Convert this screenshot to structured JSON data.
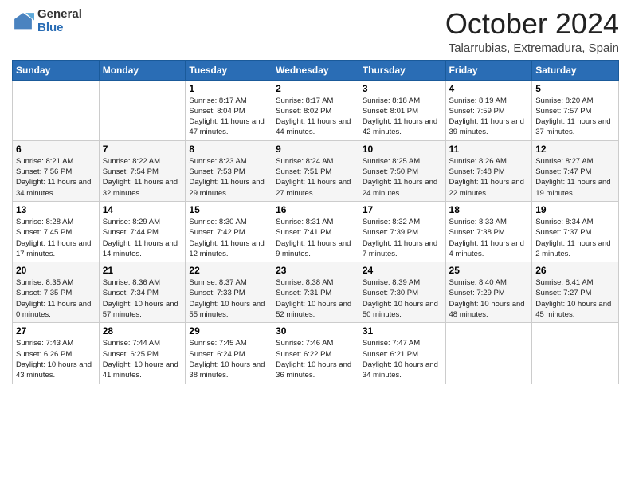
{
  "header": {
    "logo_general": "General",
    "logo_blue": "Blue",
    "title": "October 2024",
    "subtitle": "Talarrubias, Extremadura, Spain"
  },
  "weekdays": [
    "Sunday",
    "Monday",
    "Tuesday",
    "Wednesday",
    "Thursday",
    "Friday",
    "Saturday"
  ],
  "weeks": [
    [
      {
        "day": "",
        "info": ""
      },
      {
        "day": "",
        "info": ""
      },
      {
        "day": "1",
        "info": "Sunrise: 8:17 AM\nSunset: 8:04 PM\nDaylight: 11 hours and 47 minutes."
      },
      {
        "day": "2",
        "info": "Sunrise: 8:17 AM\nSunset: 8:02 PM\nDaylight: 11 hours and 44 minutes."
      },
      {
        "day": "3",
        "info": "Sunrise: 8:18 AM\nSunset: 8:01 PM\nDaylight: 11 hours and 42 minutes."
      },
      {
        "day": "4",
        "info": "Sunrise: 8:19 AM\nSunset: 7:59 PM\nDaylight: 11 hours and 39 minutes."
      },
      {
        "day": "5",
        "info": "Sunrise: 8:20 AM\nSunset: 7:57 PM\nDaylight: 11 hours and 37 minutes."
      }
    ],
    [
      {
        "day": "6",
        "info": "Sunrise: 8:21 AM\nSunset: 7:56 PM\nDaylight: 11 hours and 34 minutes."
      },
      {
        "day": "7",
        "info": "Sunrise: 8:22 AM\nSunset: 7:54 PM\nDaylight: 11 hours and 32 minutes."
      },
      {
        "day": "8",
        "info": "Sunrise: 8:23 AM\nSunset: 7:53 PM\nDaylight: 11 hours and 29 minutes."
      },
      {
        "day": "9",
        "info": "Sunrise: 8:24 AM\nSunset: 7:51 PM\nDaylight: 11 hours and 27 minutes."
      },
      {
        "day": "10",
        "info": "Sunrise: 8:25 AM\nSunset: 7:50 PM\nDaylight: 11 hours and 24 minutes."
      },
      {
        "day": "11",
        "info": "Sunrise: 8:26 AM\nSunset: 7:48 PM\nDaylight: 11 hours and 22 minutes."
      },
      {
        "day": "12",
        "info": "Sunrise: 8:27 AM\nSunset: 7:47 PM\nDaylight: 11 hours and 19 minutes."
      }
    ],
    [
      {
        "day": "13",
        "info": "Sunrise: 8:28 AM\nSunset: 7:45 PM\nDaylight: 11 hours and 17 minutes."
      },
      {
        "day": "14",
        "info": "Sunrise: 8:29 AM\nSunset: 7:44 PM\nDaylight: 11 hours and 14 minutes."
      },
      {
        "day": "15",
        "info": "Sunrise: 8:30 AM\nSunset: 7:42 PM\nDaylight: 11 hours and 12 minutes."
      },
      {
        "day": "16",
        "info": "Sunrise: 8:31 AM\nSunset: 7:41 PM\nDaylight: 11 hours and 9 minutes."
      },
      {
        "day": "17",
        "info": "Sunrise: 8:32 AM\nSunset: 7:39 PM\nDaylight: 11 hours and 7 minutes."
      },
      {
        "day": "18",
        "info": "Sunrise: 8:33 AM\nSunset: 7:38 PM\nDaylight: 11 hours and 4 minutes."
      },
      {
        "day": "19",
        "info": "Sunrise: 8:34 AM\nSunset: 7:37 PM\nDaylight: 11 hours and 2 minutes."
      }
    ],
    [
      {
        "day": "20",
        "info": "Sunrise: 8:35 AM\nSunset: 7:35 PM\nDaylight: 11 hours and 0 minutes."
      },
      {
        "day": "21",
        "info": "Sunrise: 8:36 AM\nSunset: 7:34 PM\nDaylight: 10 hours and 57 minutes."
      },
      {
        "day": "22",
        "info": "Sunrise: 8:37 AM\nSunset: 7:33 PM\nDaylight: 10 hours and 55 minutes."
      },
      {
        "day": "23",
        "info": "Sunrise: 8:38 AM\nSunset: 7:31 PM\nDaylight: 10 hours and 52 minutes."
      },
      {
        "day": "24",
        "info": "Sunrise: 8:39 AM\nSunset: 7:30 PM\nDaylight: 10 hours and 50 minutes."
      },
      {
        "day": "25",
        "info": "Sunrise: 8:40 AM\nSunset: 7:29 PM\nDaylight: 10 hours and 48 minutes."
      },
      {
        "day": "26",
        "info": "Sunrise: 8:41 AM\nSunset: 7:27 PM\nDaylight: 10 hours and 45 minutes."
      }
    ],
    [
      {
        "day": "27",
        "info": "Sunrise: 7:43 AM\nSunset: 6:26 PM\nDaylight: 10 hours and 43 minutes."
      },
      {
        "day": "28",
        "info": "Sunrise: 7:44 AM\nSunset: 6:25 PM\nDaylight: 10 hours and 41 minutes."
      },
      {
        "day": "29",
        "info": "Sunrise: 7:45 AM\nSunset: 6:24 PM\nDaylight: 10 hours and 38 minutes."
      },
      {
        "day": "30",
        "info": "Sunrise: 7:46 AM\nSunset: 6:22 PM\nDaylight: 10 hours and 36 minutes."
      },
      {
        "day": "31",
        "info": "Sunrise: 7:47 AM\nSunset: 6:21 PM\nDaylight: 10 hours and 34 minutes."
      },
      {
        "day": "",
        "info": ""
      },
      {
        "day": "",
        "info": ""
      }
    ]
  ]
}
